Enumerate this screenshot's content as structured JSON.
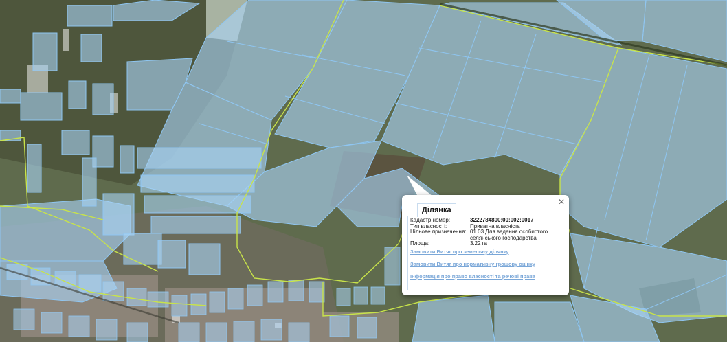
{
  "colors": {
    "parcel_fill": "#a9d3f5",
    "parcel_stroke": "#8fc6f2",
    "boundary": "#c8e34a",
    "link": "#7aa7d8"
  },
  "popup": {
    "close_icon": "✕",
    "tab_label": "Ділянка",
    "fields": [
      {
        "key": "Кадастр.номер:",
        "value": "3222784800:00:002:0017"
      },
      {
        "key": "Тип власності:",
        "value": "Приватна власність"
      },
      {
        "key": "Цільове призначення:",
        "value": "01.03 Для ведення особистого селянського господарства"
      },
      {
        "key": "Площа:",
        "value": "3.22 га"
      }
    ],
    "links": [
      "Замовити Витяг про земельну ділянку",
      "Замовити Витяг про нормативну грошову оцінку",
      "Інформація про право власності та речові права"
    ]
  }
}
